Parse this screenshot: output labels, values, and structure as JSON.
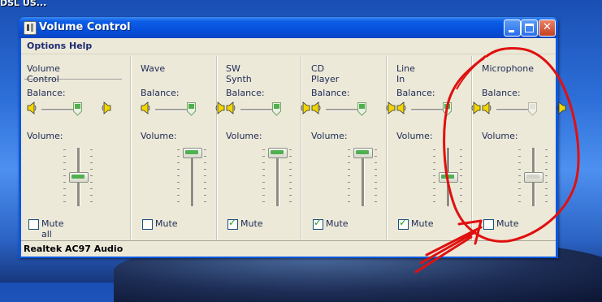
{
  "desktop": {
    "top_text": "DSL US..."
  },
  "window": {
    "title": "Volume Control",
    "buttons": {
      "close": "✕"
    }
  },
  "menu": [
    "Options",
    "Help"
  ],
  "columns": [
    {
      "label": "Volume Control",
      "balance_label": "Balance:",
      "volume_label": "Volume:",
      "mute_label": "Mute all",
      "muted": false,
      "volume_percent": 50,
      "enabled": true
    },
    {
      "label": "Wave",
      "balance_label": "Balance:",
      "volume_label": "Volume:",
      "mute_label": "Mute",
      "muted": false,
      "volume_percent": 100,
      "enabled": true
    },
    {
      "label": "SW Synth",
      "balance_label": "Balance:",
      "volume_label": "Volume:",
      "mute_label": "Mute",
      "muted": true,
      "volume_percent": 100,
      "enabled": true
    },
    {
      "label": "CD Player",
      "balance_label": "Balance:",
      "volume_label": "Volume:",
      "mute_label": "Mute",
      "muted": true,
      "volume_percent": 100,
      "enabled": true
    },
    {
      "label": "Line In",
      "balance_label": "Balance:",
      "volume_label": "Volume:",
      "mute_label": "Mute",
      "muted": true,
      "volume_percent": 50,
      "enabled": true
    },
    {
      "label": "Microphone",
      "balance_label": "Balance:",
      "volume_label": "Volume:",
      "mute_label": "Mute",
      "muted": false,
      "volume_percent": 50,
      "enabled": false
    }
  ],
  "status_bar": "Realtek AC97 Audio",
  "colors": {
    "annotation": "#e01010"
  }
}
